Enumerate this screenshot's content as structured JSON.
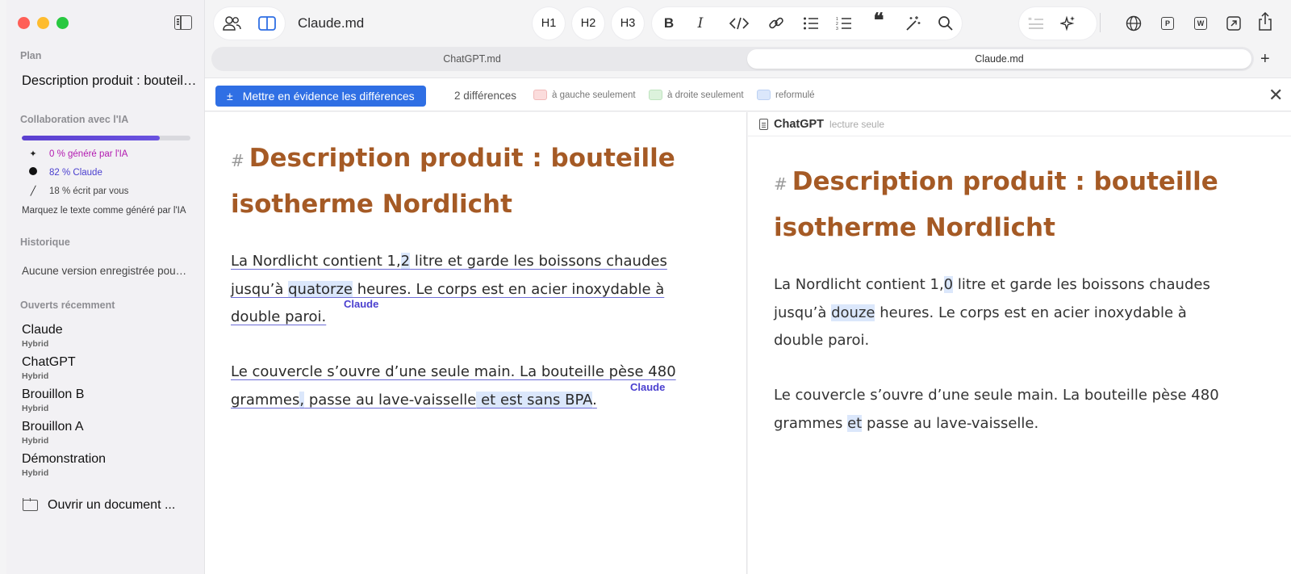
{
  "window": {
    "doc_title": "Claude.md"
  },
  "sidebar": {
    "plan_title": "Plan",
    "plan_item": "Description produit : bouteille isotherme Nordlicht",
    "collab_title": "Collaboration avec l'IA",
    "ai_progress_fraction": 0.82,
    "stats": {
      "ai": "0 % généré par l'IA",
      "claude": "82 % Claude",
      "you": "18 % écrit par vous"
    },
    "mark_text": "Marquez le texte comme généré par l'IA",
    "history_title": "Historique",
    "no_version": "Aucune version enregistrée pour ce document",
    "recent_title": "Ouverts récemment",
    "recent": [
      {
        "name": "Claude",
        "sub": "Hybrid"
      },
      {
        "name": "ChatGPT",
        "sub": "Hybrid"
      },
      {
        "name": "Brouillon B",
        "sub": "Hybrid"
      },
      {
        "name": "Brouillon A",
        "sub": "Hybrid"
      },
      {
        "name": "Démonstration",
        "sub": "Hybrid"
      }
    ],
    "open_doc": "Ouvrir un document ..."
  },
  "toolbar": {
    "h1": "H1",
    "h2": "H2",
    "h3": "H3",
    "bold": "B",
    "italic": "I"
  },
  "tabs": {
    "left": "ChatGPT.md",
    "right": "Claude.md",
    "add": "+"
  },
  "diffbar": {
    "button_icon": "±",
    "button_label": "Mettre en évidence les différences",
    "count": "2 différences",
    "legend_left": "à gauche seulement",
    "legend_right": "à droite seulement",
    "legend_reformulated": "reformulé",
    "colors": {
      "left_only": "#fbdcdc",
      "right_only": "#dcf2dc",
      "reformulated": "#dbe7fb"
    }
  },
  "left_doc": {
    "hash": "#",
    "heading_line1": "Description produit : bouteille",
    "heading_line2": "isotherme Nordlicht",
    "p1": {
      "l1_a": "La Nordlicht contient 1,",
      "l1_hl": "2",
      "l1_b": " litre et garde les boissons chaudes",
      "l2_a": "jusqu’à ",
      "l2_hl": "quatorze",
      "l2_b": " heures. Le corps est en acier inoxydable à",
      "l3": "double paroi."
    },
    "p2": {
      "l1": "Le couvercle s’ouvre d’une seule main. La bouteille pèse 480",
      "l2_a": "grammes",
      "l2_hl1": ",",
      "l2_b": " passe au lave-vaisselle",
      "l2_hl2": " et est sans BPA",
      "l2_c": "."
    },
    "author_tag": "Claude"
  },
  "right_doc": {
    "name": "ChatGPT",
    "readonly_note": "lecture seule",
    "hash": "#",
    "heading_line1": "Description produit : bouteille",
    "heading_line2": "isotherme Nordlicht",
    "p1": {
      "l1_a": "La Nordlicht contient 1,",
      "l1_hl": "0",
      "l1_b": " litre et garde les boissons chaudes",
      "l2_a": "jusqu’à ",
      "l2_hl": "douze",
      "l2_b": " heures. Le corps est en acier inoxydable à",
      "l3": "double paroi."
    },
    "p2": {
      "l1": "Le couvercle s’ouvre d’une seule main. La bouteille pèse 480",
      "l2_a": "grammes ",
      "l2_hl": "et",
      "l2_b": " passe au lave-vaisselle."
    }
  }
}
